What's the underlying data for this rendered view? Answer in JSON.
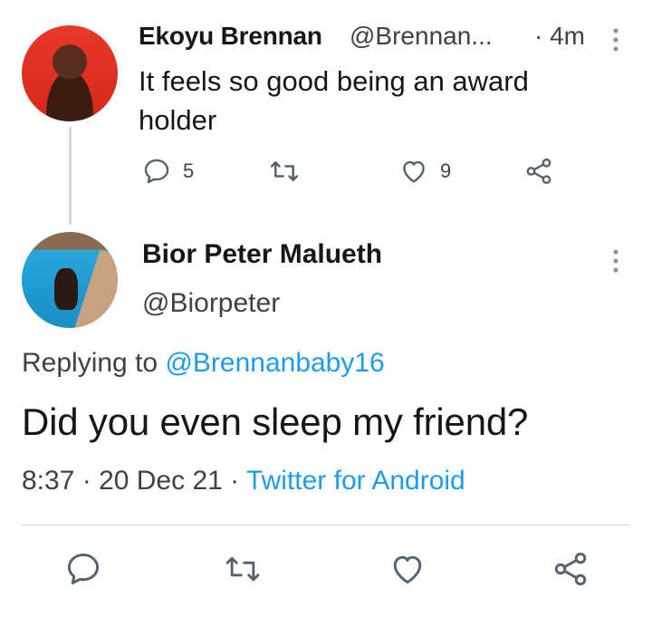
{
  "parent_tweet": {
    "name": "Ekoyu Brennan",
    "handle": "@Brennan...",
    "time": "· 4m",
    "text": "It feels so good being an award holder",
    "replies": "5",
    "likes": "9",
    "avatar_bg": "#e8382a"
  },
  "reply_tweet": {
    "name": "Bior Peter Malueth",
    "handle": "@Biorpeter",
    "replying_prefix": "Replying to ",
    "replying_to": "@Brennanbaby16",
    "text": "Did you even sleep my friend?",
    "time": "8:37",
    "sep1": " · ",
    "date": "20 Dec 21",
    "sep2": " · ",
    "source": "Twitter for Android"
  },
  "colors": {
    "accent": "#1d9bf0",
    "secondary_text": "#3c4248",
    "icon": "#536471",
    "divider": "#cfd9de"
  },
  "icons": [
    "reply-icon",
    "retweet-icon",
    "like-icon",
    "share-icon",
    "more-options-icon"
  ]
}
